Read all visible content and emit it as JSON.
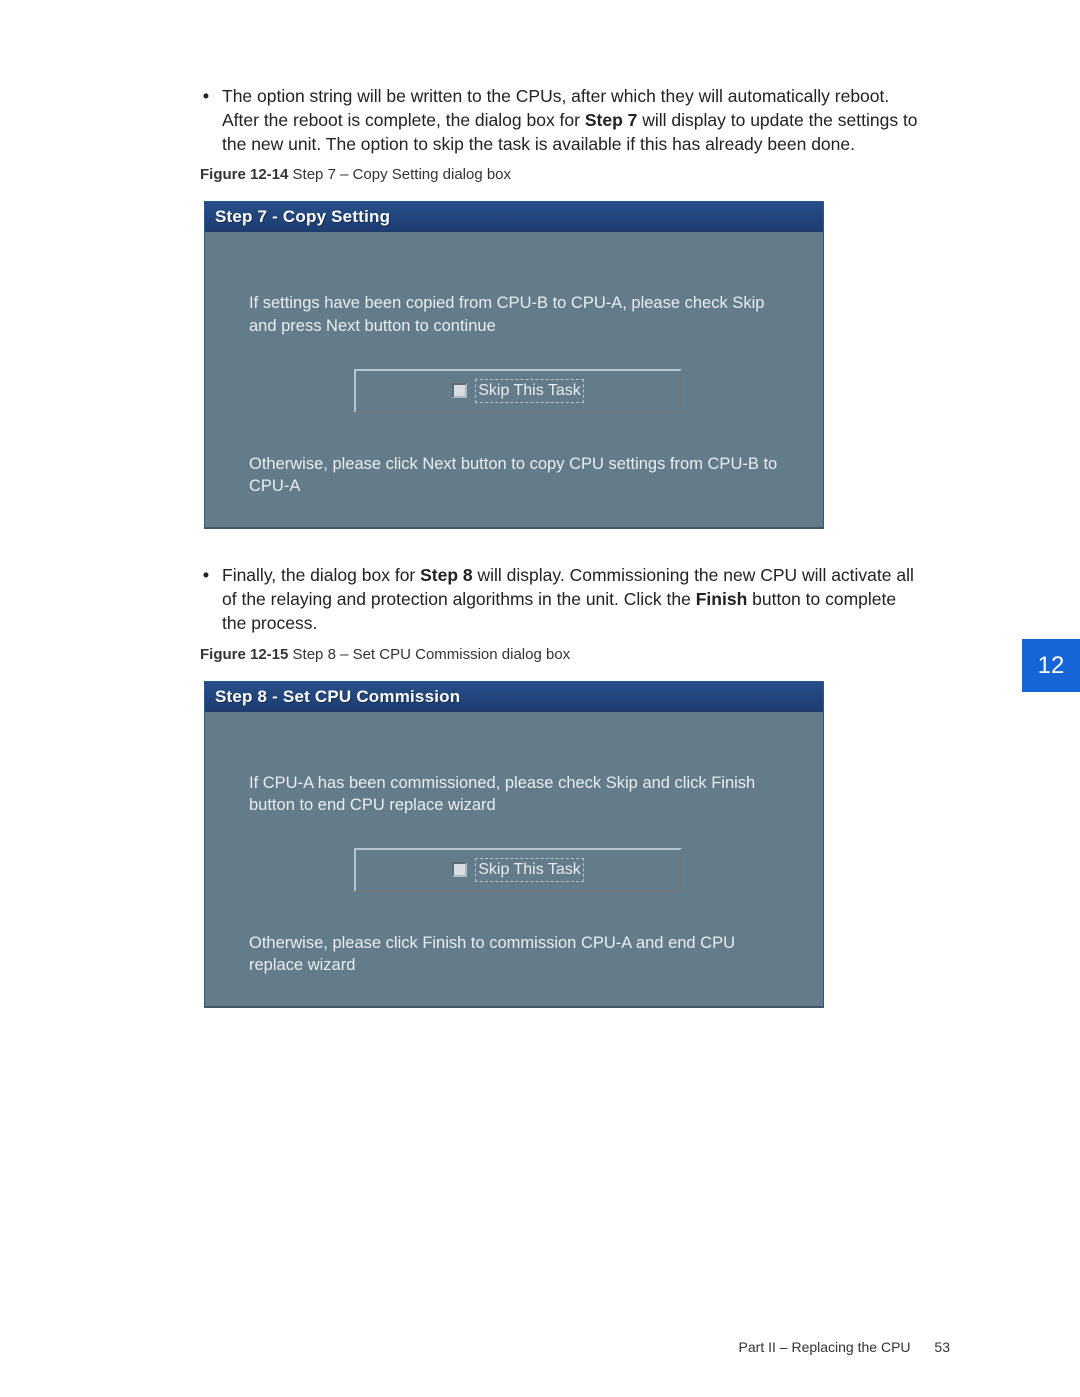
{
  "bullets": {
    "b1_pre": "The option string will be written to the CPUs, after which they will automatically reboot. After the reboot is complete, the dialog box for ",
    "b1_bold": "Step 7",
    "b1_post": " will display to update the settings to the new unit. The option to skip the task is available if this has already been done.",
    "b3_pre": "Finally, the dialog box for ",
    "b3_bold1": "Step 8",
    "b3_mid": " will display. Commissioning the new CPU will activate all of the relaying and protection algorithms in the unit. Click the ",
    "b3_bold2": "Finish",
    "b3_post": " button to complete the process."
  },
  "captions": {
    "c1_bold": "Figure 12-14",
    "c1_rest": "  Step 7 – Copy Setting dialog box",
    "c2_bold": "Figure 12-15",
    "c2_rest": "  Step 8 – Set CPU Commission dialog box"
  },
  "dialog1": {
    "title": "Step 7 - Copy Setting",
    "msg": "If settings have been copied from CPU-B to CPU-A, please check Skip and press Next button to continue",
    "skip": "Skip This Task",
    "lower": "Otherwise, please click Next button to copy CPU settings from CPU-B to CPU-A"
  },
  "dialog2": {
    "title": "Step 8 - Set CPU Commission",
    "msg": "If CPU-A has been commissioned, please check Skip and click Finish button to end CPU replace wizard",
    "skip": "Skip This Task",
    "lower": "Otherwise, please click Finish to commission CPU-A and end CPU replace wizard"
  },
  "side_tab": "12",
  "footer": {
    "section": "Part II – Replacing the CPU",
    "page": "53"
  }
}
